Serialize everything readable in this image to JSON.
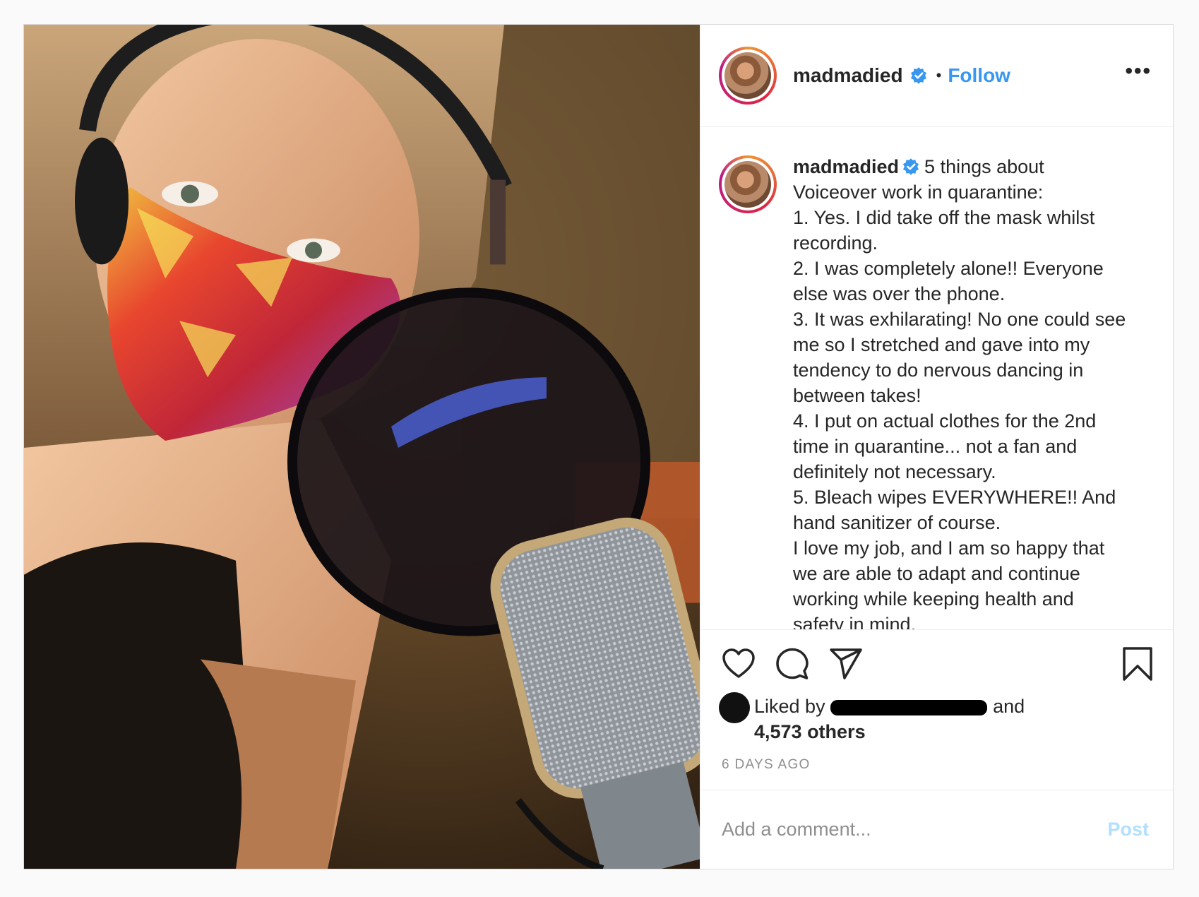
{
  "post": {
    "header": {
      "username": "madmadied",
      "separator": "•",
      "follow_label": "Follow",
      "more_label": "•••"
    },
    "photo": {
      "description_icon": "selfie-photo",
      "colors": {
        "background": "#3b2a1d",
        "mask": "#d9342b",
        "microphone": "#9aa0a6"
      }
    },
    "caption": {
      "username": "madmadied",
      "text": "5 things about\nVoiceover work in quarantine:\n1. Yes. I did take off the mask whilst\nrecording.\n2. I was completely alone!! Everyone\nelse was over the phone.\n3. It was exhilarating! No one could see\nme so I stretched and gave into my\ntendency to do nervous dancing in\nbetween takes!\n4. I put on actual clothes for the 2nd\ntime in quarantine... not a fan and\ndefinitely not necessary.\n5. Bleach wipes EVERYWHERE!! And\nhand sanitizer of course.\nI love my job, and I am so happy that\nwe are able to adapt and continue\nworking while keeping health and\nsafety in mind."
    },
    "actions": {
      "icons": [
        "heart-icon",
        "comment-icon",
        "share-icon",
        "bookmark-icon"
      ]
    },
    "likes": {
      "prefix": "Liked by",
      "suffix": "and",
      "count_label": "4,573 others"
    },
    "timestamp": "6 DAYS AGO",
    "comment_box": {
      "placeholder": "Add a comment...",
      "post_label": "Post"
    },
    "colors": {
      "link_blue": "#3897f0",
      "verified_blue": "#3897f0",
      "post_disabled": "#b2dffc",
      "muted_text": "#8e8e8e"
    }
  }
}
